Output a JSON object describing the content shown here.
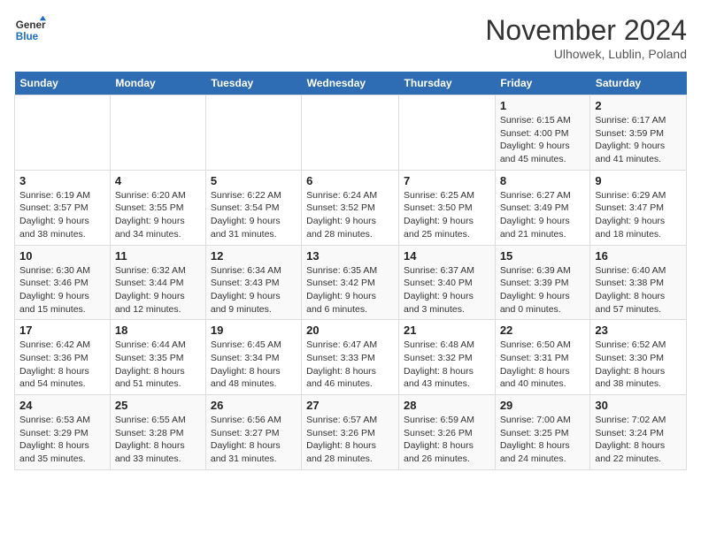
{
  "logo": {
    "line1": "General",
    "line2": "Blue"
  },
  "title": "November 2024",
  "subtitle": "Ulhowek, Lublin, Poland",
  "days_of_week": [
    "Sunday",
    "Monday",
    "Tuesday",
    "Wednesday",
    "Thursday",
    "Friday",
    "Saturday"
  ],
  "weeks": [
    [
      {
        "day": "",
        "info": ""
      },
      {
        "day": "",
        "info": ""
      },
      {
        "day": "",
        "info": ""
      },
      {
        "day": "",
        "info": ""
      },
      {
        "day": "",
        "info": ""
      },
      {
        "day": "1",
        "info": "Sunrise: 6:15 AM\nSunset: 4:00 PM\nDaylight: 9 hours and 45 minutes."
      },
      {
        "day": "2",
        "info": "Sunrise: 6:17 AM\nSunset: 3:59 PM\nDaylight: 9 hours and 41 minutes."
      }
    ],
    [
      {
        "day": "3",
        "info": "Sunrise: 6:19 AM\nSunset: 3:57 PM\nDaylight: 9 hours and 38 minutes."
      },
      {
        "day": "4",
        "info": "Sunrise: 6:20 AM\nSunset: 3:55 PM\nDaylight: 9 hours and 34 minutes."
      },
      {
        "day": "5",
        "info": "Sunrise: 6:22 AM\nSunset: 3:54 PM\nDaylight: 9 hours and 31 minutes."
      },
      {
        "day": "6",
        "info": "Sunrise: 6:24 AM\nSunset: 3:52 PM\nDaylight: 9 hours and 28 minutes."
      },
      {
        "day": "7",
        "info": "Sunrise: 6:25 AM\nSunset: 3:50 PM\nDaylight: 9 hours and 25 minutes."
      },
      {
        "day": "8",
        "info": "Sunrise: 6:27 AM\nSunset: 3:49 PM\nDaylight: 9 hours and 21 minutes."
      },
      {
        "day": "9",
        "info": "Sunrise: 6:29 AM\nSunset: 3:47 PM\nDaylight: 9 hours and 18 minutes."
      }
    ],
    [
      {
        "day": "10",
        "info": "Sunrise: 6:30 AM\nSunset: 3:46 PM\nDaylight: 9 hours and 15 minutes."
      },
      {
        "day": "11",
        "info": "Sunrise: 6:32 AM\nSunset: 3:44 PM\nDaylight: 9 hours and 12 minutes."
      },
      {
        "day": "12",
        "info": "Sunrise: 6:34 AM\nSunset: 3:43 PM\nDaylight: 9 hours and 9 minutes."
      },
      {
        "day": "13",
        "info": "Sunrise: 6:35 AM\nSunset: 3:42 PM\nDaylight: 9 hours and 6 minutes."
      },
      {
        "day": "14",
        "info": "Sunrise: 6:37 AM\nSunset: 3:40 PM\nDaylight: 9 hours and 3 minutes."
      },
      {
        "day": "15",
        "info": "Sunrise: 6:39 AM\nSunset: 3:39 PM\nDaylight: 9 hours and 0 minutes."
      },
      {
        "day": "16",
        "info": "Sunrise: 6:40 AM\nSunset: 3:38 PM\nDaylight: 8 hours and 57 minutes."
      }
    ],
    [
      {
        "day": "17",
        "info": "Sunrise: 6:42 AM\nSunset: 3:36 PM\nDaylight: 8 hours and 54 minutes."
      },
      {
        "day": "18",
        "info": "Sunrise: 6:44 AM\nSunset: 3:35 PM\nDaylight: 8 hours and 51 minutes."
      },
      {
        "day": "19",
        "info": "Sunrise: 6:45 AM\nSunset: 3:34 PM\nDaylight: 8 hours and 48 minutes."
      },
      {
        "day": "20",
        "info": "Sunrise: 6:47 AM\nSunset: 3:33 PM\nDaylight: 8 hours and 46 minutes."
      },
      {
        "day": "21",
        "info": "Sunrise: 6:48 AM\nSunset: 3:32 PM\nDaylight: 8 hours and 43 minutes."
      },
      {
        "day": "22",
        "info": "Sunrise: 6:50 AM\nSunset: 3:31 PM\nDaylight: 8 hours and 40 minutes."
      },
      {
        "day": "23",
        "info": "Sunrise: 6:52 AM\nSunset: 3:30 PM\nDaylight: 8 hours and 38 minutes."
      }
    ],
    [
      {
        "day": "24",
        "info": "Sunrise: 6:53 AM\nSunset: 3:29 PM\nDaylight: 8 hours and 35 minutes."
      },
      {
        "day": "25",
        "info": "Sunrise: 6:55 AM\nSunset: 3:28 PM\nDaylight: 8 hours and 33 minutes."
      },
      {
        "day": "26",
        "info": "Sunrise: 6:56 AM\nSunset: 3:27 PM\nDaylight: 8 hours and 31 minutes."
      },
      {
        "day": "27",
        "info": "Sunrise: 6:57 AM\nSunset: 3:26 PM\nDaylight: 8 hours and 28 minutes."
      },
      {
        "day": "28",
        "info": "Sunrise: 6:59 AM\nSunset: 3:26 PM\nDaylight: 8 hours and 26 minutes."
      },
      {
        "day": "29",
        "info": "Sunrise: 7:00 AM\nSunset: 3:25 PM\nDaylight: 8 hours and 24 minutes."
      },
      {
        "day": "30",
        "info": "Sunrise: 7:02 AM\nSunset: 3:24 PM\nDaylight: 8 hours and 22 minutes."
      }
    ]
  ]
}
